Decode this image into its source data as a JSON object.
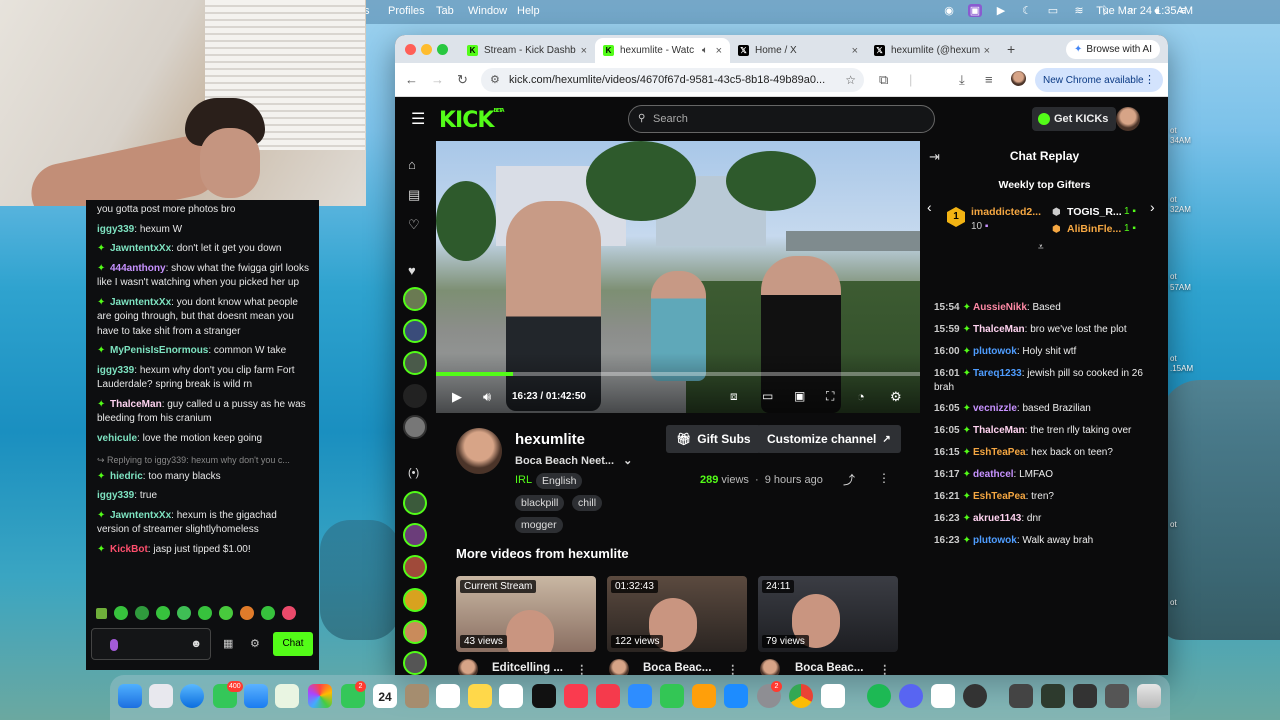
{
  "menubar": {
    "items": [
      "Profiles",
      "Tab",
      "Window",
      "Help"
    ],
    "clock": "Tue Mar 24  1:35AM"
  },
  "desktop_labels": [
    "ot",
    "34AM",
    "ot",
    "32AM",
    "ot",
    "57AM",
    "ot",
    ".15AM",
    "ot",
    "ot"
  ],
  "left_chat": {
    "messages": [
      {
        "user": "",
        "text": "you gotta post more photos bro",
        "color": "#ff6b6b",
        "badge": false
      },
      {
        "user": "iggy339",
        "text": "hexum W",
        "color": "#7ee3c1",
        "badge": false
      },
      {
        "user": "JawntentxXx",
        "text": "don't let it get you down",
        "color": "#7ee3c1",
        "badge": true
      },
      {
        "user": "444anthony",
        "text": "show what the fwigga girl looks like I wasn't watching when you picked her up",
        "color": "#c792ff",
        "badge": true
      },
      {
        "user": "JawntentxXx",
        "text": "you dont know what people are going through, but that doesnt mean you have to take shit from a stranger",
        "color": "#7ee3c1",
        "badge": true
      },
      {
        "user": "MyPenisIsEnormous",
        "text": "common W take",
        "color": "#7ee3c1",
        "badge": true
      },
      {
        "user": "iggy339",
        "text": "hexum why don't you clip farm Fort Lauderdale? spring break is wild rn",
        "color": "#7ee3c1",
        "badge": false
      },
      {
        "user": "ThalceMan",
        "text": "guy called u a pussy as he was bleeding from his cranium",
        "color": "#ffd3f0",
        "badge": true
      },
      {
        "user": "vehicule",
        "text": "love the motion keep going",
        "color": "#7ee3c1",
        "badge": false
      }
    ],
    "reply_context": "Replying to iggy339: hexum why don't you c...",
    "messages2": [
      {
        "user": "hiedric",
        "text": "too many blacks",
        "color": "#7ee3c1",
        "badge": true
      },
      {
        "user": "iggy339",
        "text": "true",
        "color": "#7ee3c1",
        "badge": false
      },
      {
        "user": "JawntentxXx",
        "text": "hexum is the gigachad version of streamer slightlyhomeless",
        "color": "#7ee3c1",
        "badge": true
      },
      {
        "user": "KickBot",
        "text": "jasp just tipped $1.00!",
        "color": "#ff4f6d",
        "badge": true
      }
    ],
    "chat_button": "Chat"
  },
  "browser": {
    "tabs": [
      {
        "label": "Stream - Kick Dashb",
        "icon": "kick-icon",
        "active": false
      },
      {
        "label": "hexumlite - Watc",
        "icon": "kick-icon",
        "active": true
      },
      {
        "label": "Home / X",
        "icon": "x-icon",
        "active": false
      },
      {
        "label": "hexumlite (@hexum",
        "icon": "x-icon",
        "active": false
      }
    ],
    "browse_ai": "Browse with AI",
    "url": "kick.com/hexumlite/videos/4670f67d-9581-43c5-8b18-49b89a0...",
    "new_chrome": "New Chrome available"
  },
  "kick": {
    "logo": "KICK",
    "logo_sup": "BETA",
    "search_placeholder": "Search",
    "get_kicks": "Get KICKs",
    "video": {
      "current": "16:23",
      "separator": "/",
      "duration": "01:42:50",
      "progress": 0.16
    },
    "channel": {
      "name": "hexumlite",
      "title": "Boca Beach Neet...",
      "category": "IRL",
      "language": "English",
      "tags": [
        "blackpill",
        "chill",
        "mogger"
      ],
      "views_count": "289",
      "views_label": "views",
      "ago": "9 hours ago",
      "gift_subs": "Gift Subs",
      "customize": "Customize channel"
    },
    "more_videos_title": "More videos from hexumlite",
    "thumbs": [
      {
        "tag": "Current Stream",
        "views": "43 views",
        "title": "Editcelling ..."
      },
      {
        "tag": "01:32:43",
        "views": "122 views",
        "title": "Boca Beac..."
      },
      {
        "tag": "24:11",
        "views": "79 views",
        "title": "Boca Beac..."
      }
    ],
    "chat_replay": {
      "title": "Chat Replay",
      "gifters_title": "Weekly top Gifters",
      "gifter1": "imaddicted2...",
      "gifter1_count": "10",
      "gifter2": "TOGIS_R...",
      "gifter2_count": "1",
      "gifter3": "AliBinFle...",
      "gifter3_count": "1",
      "messages": [
        {
          "ts": "15:54",
          "user": "AussieNikk",
          "text": "Based",
          "color": "#ff8aa6"
        },
        {
          "ts": "15:59",
          "user": "ThalceMan",
          "text": "bro we've lost the plot",
          "color": "#ffd3f0"
        },
        {
          "ts": "16:00",
          "user": "plutowok",
          "text": "Holy shit wtf",
          "color": "#4f9dff"
        },
        {
          "ts": "16:01",
          "user": "Tareq1233",
          "text": "jewish pill so cooked in 26 brah",
          "color": "#4f9dff"
        },
        {
          "ts": "16:05",
          "user": "vecnizzle",
          "text": "based Brazilian",
          "color": "#c792ff"
        },
        {
          "ts": "16:05",
          "user": "ThalceMan",
          "text": "the tren rlly taking over",
          "color": "#ffd3f0"
        },
        {
          "ts": "16:15",
          "user": "EshTeaPea",
          "text": "hex back on teen?",
          "color": "#f5a742"
        },
        {
          "ts": "16:17",
          "user": "deathcel",
          "text": "LMFAO",
          "color": "#c792ff"
        },
        {
          "ts": "16:21",
          "user": "EshTeaPea",
          "text": "tren?",
          "color": "#f5a742"
        },
        {
          "ts": "16:23",
          "user": "akrue1143",
          "text": "dnr",
          "color": "#ffd3f0"
        },
        {
          "ts": "16:23",
          "user": "plutowok",
          "text": "Walk away brah",
          "color": "#4f9dff"
        }
      ]
    }
  },
  "dock": {
    "messages_badge": "400",
    "facetime_badge": "2",
    "calendar_day": "24",
    "settings_badge": "2"
  }
}
